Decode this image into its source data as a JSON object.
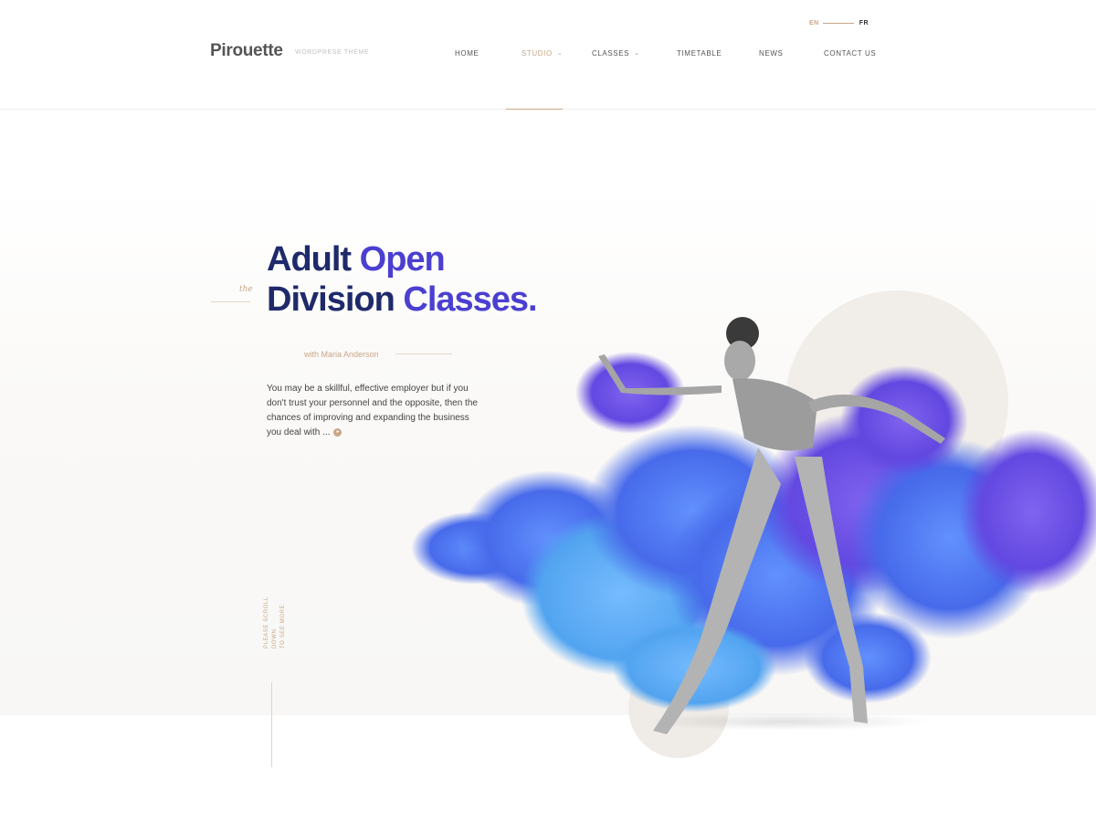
{
  "lang": {
    "active": "EN",
    "other": "FR"
  },
  "brand": {
    "logo": "Pirouette",
    "tagline": "WORDPRESE THEME"
  },
  "nav": {
    "items": [
      {
        "label": "HOME",
        "has_dropdown": false,
        "active": false
      },
      {
        "label": "STUDIO",
        "has_dropdown": true,
        "active": true
      },
      {
        "label": "CLASSES",
        "has_dropdown": true,
        "active": false
      },
      {
        "label": "TIMETABLE",
        "has_dropdown": false,
        "active": false
      },
      {
        "label": "NEWS",
        "has_dropdown": false,
        "active": false
      },
      {
        "label": "CONTACT US",
        "has_dropdown": false,
        "active": false
      }
    ]
  },
  "hero": {
    "prefix": "the",
    "title_line1_dark": "Adult",
    "title_line1_light": "Open",
    "title_line2_dark": "Division",
    "title_line2_light": "Classes.",
    "instructor": "with Maria Anderson",
    "description": "You may be a skillful, effective employer but if you don't trust your personnel and the opposite, then the chances of improving and expanding the business you deal with ...",
    "more_icon": "arrow-right-icon"
  },
  "scroll": {
    "line1": "PLEASE SCROLL DOWN",
    "line2": "TO SEE MORE."
  },
  "colors": {
    "accent": "#c9a686",
    "title_dark": "#1f2a6b",
    "title_light": "#4b3fd1",
    "smoke_blue": "#3b6ff0",
    "smoke_purple": "#6a3fe6"
  }
}
